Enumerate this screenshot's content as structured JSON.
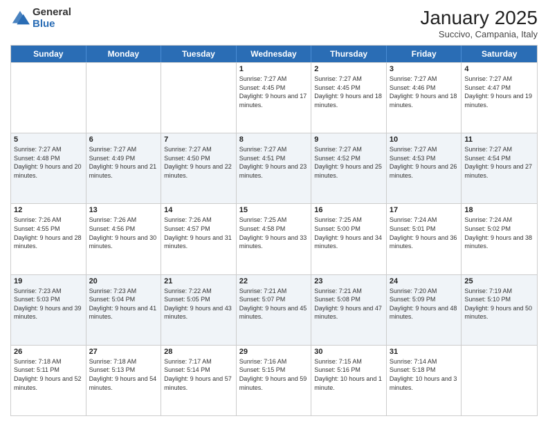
{
  "logo": {
    "general": "General",
    "blue": "Blue"
  },
  "header": {
    "month": "January 2025",
    "location": "Succivo, Campania, Italy"
  },
  "days": [
    "Sunday",
    "Monday",
    "Tuesday",
    "Wednesday",
    "Thursday",
    "Friday",
    "Saturday"
  ],
  "weeks": [
    [
      {
        "day": "",
        "sunrise": "",
        "sunset": "",
        "daylight": ""
      },
      {
        "day": "",
        "sunrise": "",
        "sunset": "",
        "daylight": ""
      },
      {
        "day": "",
        "sunrise": "",
        "sunset": "",
        "daylight": ""
      },
      {
        "day": "1",
        "sunrise": "Sunrise: 7:27 AM",
        "sunset": "Sunset: 4:45 PM",
        "daylight": "Daylight: 9 hours and 17 minutes."
      },
      {
        "day": "2",
        "sunrise": "Sunrise: 7:27 AM",
        "sunset": "Sunset: 4:45 PM",
        "daylight": "Daylight: 9 hours and 18 minutes."
      },
      {
        "day": "3",
        "sunrise": "Sunrise: 7:27 AM",
        "sunset": "Sunset: 4:46 PM",
        "daylight": "Daylight: 9 hours and 18 minutes."
      },
      {
        "day": "4",
        "sunrise": "Sunrise: 7:27 AM",
        "sunset": "Sunset: 4:47 PM",
        "daylight": "Daylight: 9 hours and 19 minutes."
      }
    ],
    [
      {
        "day": "5",
        "sunrise": "Sunrise: 7:27 AM",
        "sunset": "Sunset: 4:48 PM",
        "daylight": "Daylight: 9 hours and 20 minutes."
      },
      {
        "day": "6",
        "sunrise": "Sunrise: 7:27 AM",
        "sunset": "Sunset: 4:49 PM",
        "daylight": "Daylight: 9 hours and 21 minutes."
      },
      {
        "day": "7",
        "sunrise": "Sunrise: 7:27 AM",
        "sunset": "Sunset: 4:50 PM",
        "daylight": "Daylight: 9 hours and 22 minutes."
      },
      {
        "day": "8",
        "sunrise": "Sunrise: 7:27 AM",
        "sunset": "Sunset: 4:51 PM",
        "daylight": "Daylight: 9 hours and 23 minutes."
      },
      {
        "day": "9",
        "sunrise": "Sunrise: 7:27 AM",
        "sunset": "Sunset: 4:52 PM",
        "daylight": "Daylight: 9 hours and 25 minutes."
      },
      {
        "day": "10",
        "sunrise": "Sunrise: 7:27 AM",
        "sunset": "Sunset: 4:53 PM",
        "daylight": "Daylight: 9 hours and 26 minutes."
      },
      {
        "day": "11",
        "sunrise": "Sunrise: 7:27 AM",
        "sunset": "Sunset: 4:54 PM",
        "daylight": "Daylight: 9 hours and 27 minutes."
      }
    ],
    [
      {
        "day": "12",
        "sunrise": "Sunrise: 7:26 AM",
        "sunset": "Sunset: 4:55 PM",
        "daylight": "Daylight: 9 hours and 28 minutes."
      },
      {
        "day": "13",
        "sunrise": "Sunrise: 7:26 AM",
        "sunset": "Sunset: 4:56 PM",
        "daylight": "Daylight: 9 hours and 30 minutes."
      },
      {
        "day": "14",
        "sunrise": "Sunrise: 7:26 AM",
        "sunset": "Sunset: 4:57 PM",
        "daylight": "Daylight: 9 hours and 31 minutes."
      },
      {
        "day": "15",
        "sunrise": "Sunrise: 7:25 AM",
        "sunset": "Sunset: 4:58 PM",
        "daylight": "Daylight: 9 hours and 33 minutes."
      },
      {
        "day": "16",
        "sunrise": "Sunrise: 7:25 AM",
        "sunset": "Sunset: 5:00 PM",
        "daylight": "Daylight: 9 hours and 34 minutes."
      },
      {
        "day": "17",
        "sunrise": "Sunrise: 7:24 AM",
        "sunset": "Sunset: 5:01 PM",
        "daylight": "Daylight: 9 hours and 36 minutes."
      },
      {
        "day": "18",
        "sunrise": "Sunrise: 7:24 AM",
        "sunset": "Sunset: 5:02 PM",
        "daylight": "Daylight: 9 hours and 38 minutes."
      }
    ],
    [
      {
        "day": "19",
        "sunrise": "Sunrise: 7:23 AM",
        "sunset": "Sunset: 5:03 PM",
        "daylight": "Daylight: 9 hours and 39 minutes."
      },
      {
        "day": "20",
        "sunrise": "Sunrise: 7:23 AM",
        "sunset": "Sunset: 5:04 PM",
        "daylight": "Daylight: 9 hours and 41 minutes."
      },
      {
        "day": "21",
        "sunrise": "Sunrise: 7:22 AM",
        "sunset": "Sunset: 5:05 PM",
        "daylight": "Daylight: 9 hours and 43 minutes."
      },
      {
        "day": "22",
        "sunrise": "Sunrise: 7:21 AM",
        "sunset": "Sunset: 5:07 PM",
        "daylight": "Daylight: 9 hours and 45 minutes."
      },
      {
        "day": "23",
        "sunrise": "Sunrise: 7:21 AM",
        "sunset": "Sunset: 5:08 PM",
        "daylight": "Daylight: 9 hours and 47 minutes."
      },
      {
        "day": "24",
        "sunrise": "Sunrise: 7:20 AM",
        "sunset": "Sunset: 5:09 PM",
        "daylight": "Daylight: 9 hours and 48 minutes."
      },
      {
        "day": "25",
        "sunrise": "Sunrise: 7:19 AM",
        "sunset": "Sunset: 5:10 PM",
        "daylight": "Daylight: 9 hours and 50 minutes."
      }
    ],
    [
      {
        "day": "26",
        "sunrise": "Sunrise: 7:18 AM",
        "sunset": "Sunset: 5:11 PM",
        "daylight": "Daylight: 9 hours and 52 minutes."
      },
      {
        "day": "27",
        "sunrise": "Sunrise: 7:18 AM",
        "sunset": "Sunset: 5:13 PM",
        "daylight": "Daylight: 9 hours and 54 minutes."
      },
      {
        "day": "28",
        "sunrise": "Sunrise: 7:17 AM",
        "sunset": "Sunset: 5:14 PM",
        "daylight": "Daylight: 9 hours and 57 minutes."
      },
      {
        "day": "29",
        "sunrise": "Sunrise: 7:16 AM",
        "sunset": "Sunset: 5:15 PM",
        "daylight": "Daylight: 9 hours and 59 minutes."
      },
      {
        "day": "30",
        "sunrise": "Sunrise: 7:15 AM",
        "sunset": "Sunset: 5:16 PM",
        "daylight": "Daylight: 10 hours and 1 minute."
      },
      {
        "day": "31",
        "sunrise": "Sunrise: 7:14 AM",
        "sunset": "Sunset: 5:18 PM",
        "daylight": "Daylight: 10 hours and 3 minutes."
      },
      {
        "day": "",
        "sunrise": "",
        "sunset": "",
        "daylight": ""
      }
    ]
  ]
}
